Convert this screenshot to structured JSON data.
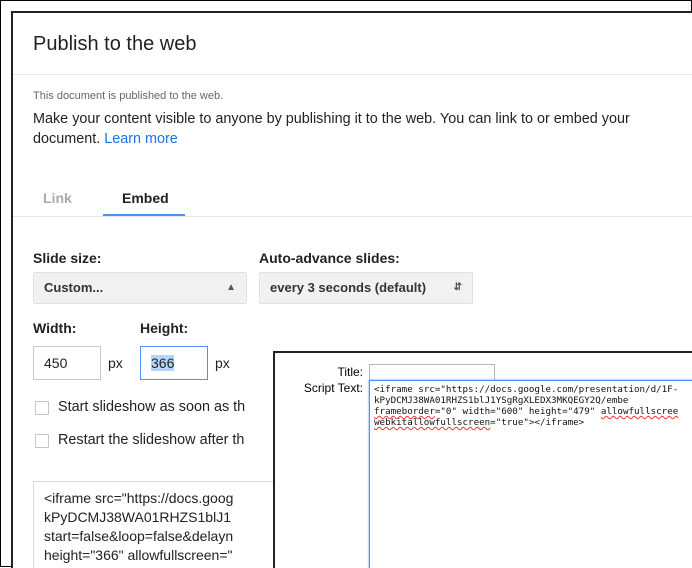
{
  "dialog": {
    "title": "Publish to the web",
    "published_note": "This document is published to the web.",
    "description": "Make your content visible to anyone by publishing it to the web. You can link to or embed your document.",
    "learn_more": "Learn more"
  },
  "tabs": {
    "link": "Link",
    "embed": "Embed",
    "active": "Embed"
  },
  "embed": {
    "slide_size_label": "Slide size:",
    "slide_size_value": "Custom...",
    "auto_advance_label": "Auto-advance slides:",
    "auto_advance_value": "every 3 seconds (default)",
    "width_label": "Width:",
    "height_label": "Height:",
    "width_value": "450",
    "height_value": "366",
    "unit": "px",
    "start_checkbox": "Start slideshow as soon as th",
    "restart_checkbox": "Restart the slideshow after th",
    "embed_code": "<iframe src=\"https://docs.goog\nkPyDCMJ38WA01RHZS1blJ1\nstart=false&loop=false&delayn\nheight=\"366\" allowfullscreen=\""
  },
  "popup": {
    "title_label": "Title:",
    "title_value": "",
    "script_label": "Script Text:",
    "script_line1": "<iframe src=\"https://docs.google.com/presentation/d/1F-",
    "script_line2": "kPyDCMJ38WA01RHZS1blJ1YSgRgXLEDX3MKQEGY2Q/embe",
    "script_line3a": "frameborder",
    "script_line3b": "=\"0\" width=\"600\" height=\"479\" ",
    "script_line3c": "allowfullscree",
    "script_line4a": "webkitallowfullscreen",
    "script_line4b": "=\"true\"></iframe>"
  }
}
